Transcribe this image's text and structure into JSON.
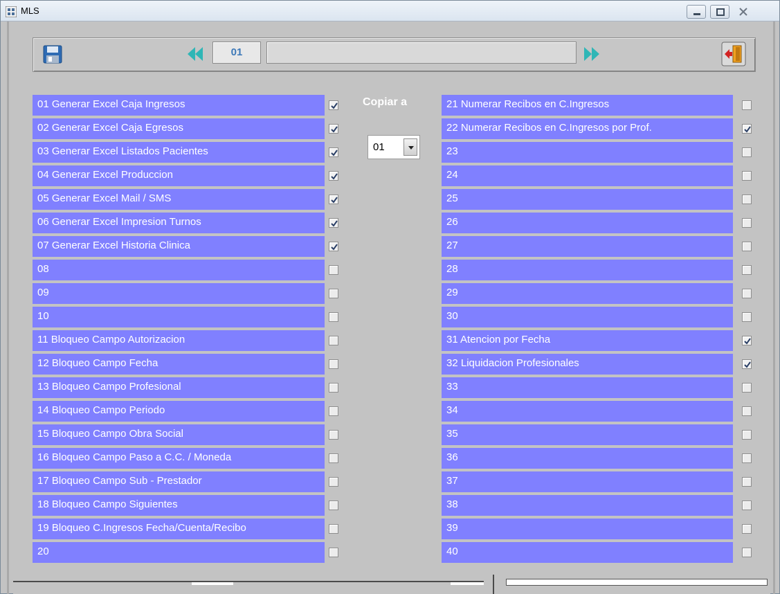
{
  "window": {
    "title": "MLS",
    "icon": "app-grid-icon",
    "controls": [
      "minimize-icon",
      "maximize-icon",
      "close-icon"
    ]
  },
  "toolbar": {
    "save_icon": "save-icon",
    "prev_icon": "rewind-icon",
    "record_number": "01",
    "record_description": "",
    "next_icon": "fast-forward-icon",
    "exit_icon": "exit-door-icon"
  },
  "copy": {
    "label": "Copiar a",
    "selected": "01"
  },
  "colors": {
    "row_background": "#8080ff",
    "window_background": "#c3c3c3",
    "record_number_text": "#3d79b8"
  },
  "options_left": [
    {
      "label": "01 Generar Excel Caja Ingresos",
      "checked": true
    },
    {
      "label": "02 Generar Excel Caja Egresos",
      "checked": true
    },
    {
      "label": "03 Generar Excel Listados Pacientes",
      "checked": true
    },
    {
      "label": "04 Generar Excel Produccion",
      "checked": true
    },
    {
      "label": "05 Generar Excel Mail / SMS",
      "checked": true
    },
    {
      "label": "06 Generar Excel Impresion Turnos",
      "checked": true
    },
    {
      "label": "07 Generar Excel Historia Clinica",
      "checked": true
    },
    {
      "label": "08",
      "checked": false
    },
    {
      "label": "09",
      "checked": false
    },
    {
      "label": "10",
      "checked": false
    },
    {
      "label": "11 Bloqueo Campo Autorizacion",
      "checked": false
    },
    {
      "label": "12 Bloqueo Campo Fecha",
      "checked": false
    },
    {
      "label": "13 Bloqueo Campo Profesional",
      "checked": false
    },
    {
      "label": "14 Bloqueo Campo Periodo",
      "checked": false
    },
    {
      "label": "15 Bloqueo Campo Obra Social",
      "checked": false
    },
    {
      "label": "16 Bloqueo Campo Paso a C.C. / Moneda",
      "checked": false
    },
    {
      "label": "17 Bloqueo Campo Sub - Prestador",
      "checked": false
    },
    {
      "label": "18 Bloqueo Campo Siguientes",
      "checked": false
    },
    {
      "label": "19 Bloqueo C.Ingresos Fecha/Cuenta/Recibo",
      "checked": false
    },
    {
      "label": "20",
      "checked": false
    }
  ],
  "options_right": [
    {
      "label": "21 Numerar Recibos en C.Ingresos",
      "checked": false
    },
    {
      "label": "22 Numerar Recibos en C.Ingresos por Prof.",
      "checked": true
    },
    {
      "label": "23",
      "checked": false
    },
    {
      "label": "24",
      "checked": false
    },
    {
      "label": "25",
      "checked": false
    },
    {
      "label": "26",
      "checked": false
    },
    {
      "label": "27",
      "checked": false
    },
    {
      "label": "28",
      "checked": false
    },
    {
      "label": "29",
      "checked": false
    },
    {
      "label": "30",
      "checked": false
    },
    {
      "label": "31 Atencion por Fecha",
      "checked": true
    },
    {
      "label": "32 Liquidacion Profesionales",
      "checked": true
    },
    {
      "label": "33",
      "checked": false
    },
    {
      "label": "34",
      "checked": false
    },
    {
      "label": "35",
      "checked": false
    },
    {
      "label": "36",
      "checked": false
    },
    {
      "label": "37",
      "checked": false
    },
    {
      "label": "38",
      "checked": false
    },
    {
      "label": "39",
      "checked": false
    },
    {
      "label": "40",
      "checked": false
    }
  ]
}
